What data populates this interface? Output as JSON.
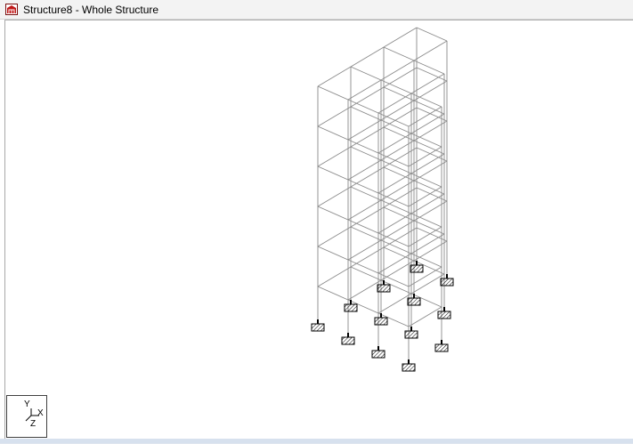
{
  "window": {
    "title": "Structure8 - Whole Structure",
    "icon": "structure-app-icon"
  },
  "view": {
    "name": "Whole Structure",
    "colors": {
      "frame_line": "#8a8a8a",
      "support": "#000000",
      "background": "#ffffff"
    }
  },
  "axis_indicator": {
    "y_label": "Y",
    "x_label": "X",
    "z_label": "Z"
  }
}
